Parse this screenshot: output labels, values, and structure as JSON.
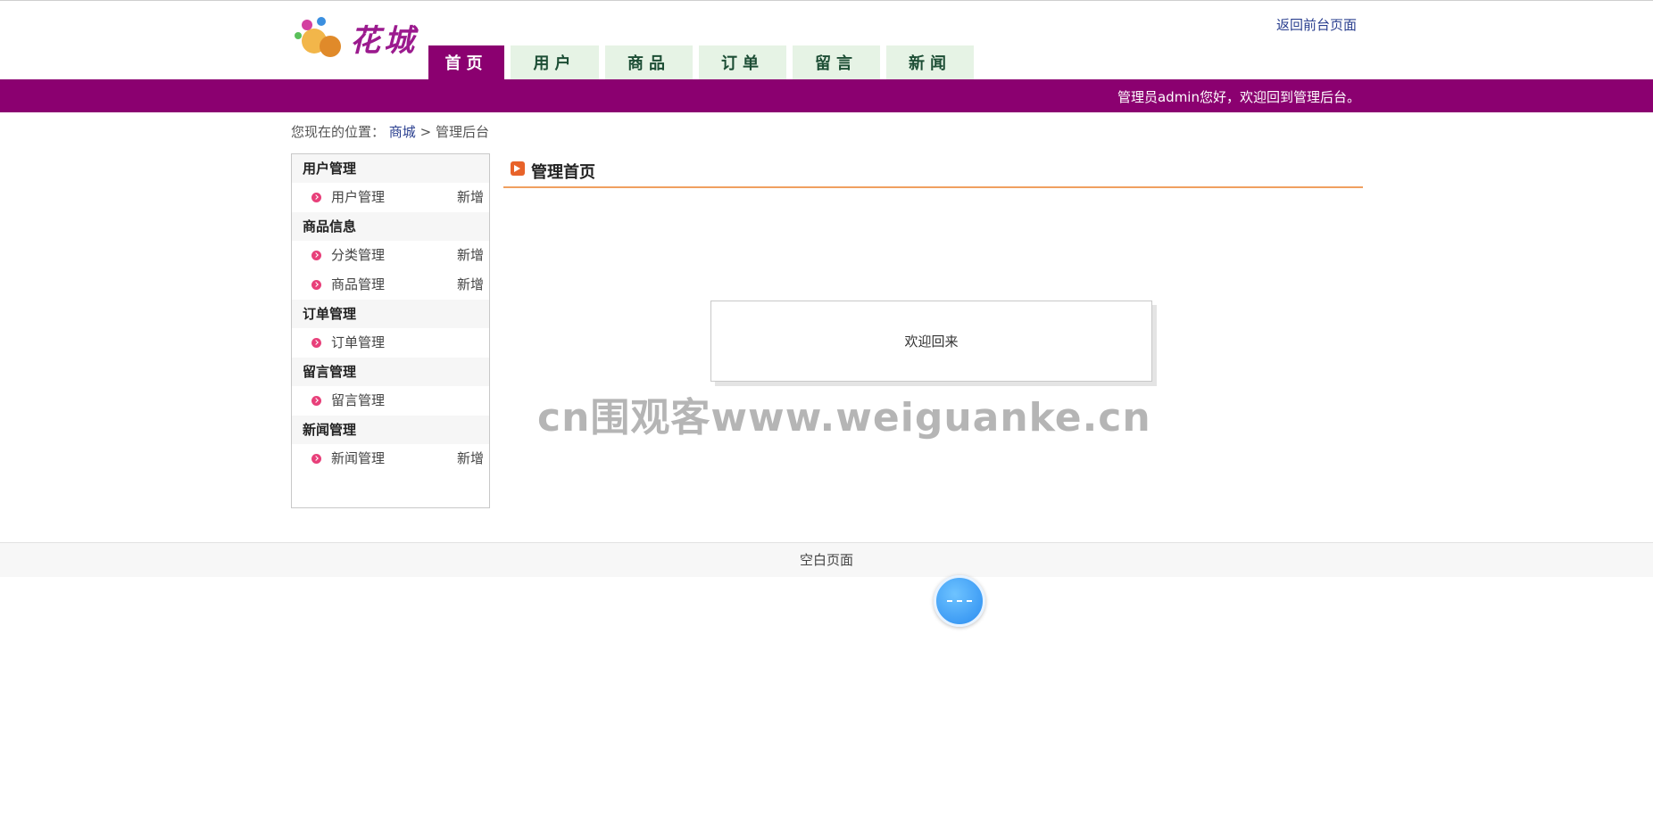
{
  "header": {
    "logo_text": "花城",
    "back_link": "返回前台页面",
    "nav": [
      "首页",
      "用户",
      "商品",
      "订单",
      "留言",
      "新闻"
    ],
    "active_nav": "首页",
    "welcome_bar": "管理员admin您好，欢迎回到管理后台。"
  },
  "breadcrumb": {
    "prefix": "您现在的位置：",
    "link": "商城",
    "sep": ">",
    "current": "管理后台"
  },
  "sidebar": {
    "groups": [
      {
        "title": "用户管理",
        "items": [
          {
            "label": "用户管理",
            "add": "新增"
          }
        ]
      },
      {
        "title": "商品信息",
        "items": [
          {
            "label": "分类管理",
            "add": "新增"
          },
          {
            "label": "商品管理",
            "add": "新增"
          }
        ]
      },
      {
        "title": "订单管理",
        "items": [
          {
            "label": "订单管理",
            "add": ""
          }
        ]
      },
      {
        "title": "留言管理",
        "items": [
          {
            "label": "留言管理",
            "add": ""
          }
        ]
      },
      {
        "title": "新闻管理",
        "items": [
          {
            "label": "新闻管理",
            "add": "新增"
          }
        ]
      }
    ]
  },
  "main": {
    "title": "管理首页",
    "welcome": "欢迎回来"
  },
  "watermark": "cn围观客www.weiguanke.cn",
  "footer": {
    "text": "空白页面"
  },
  "colors": {
    "brand": "#8b0070",
    "tab_bg": "#e6f3e5",
    "accent": "#e8632a"
  }
}
